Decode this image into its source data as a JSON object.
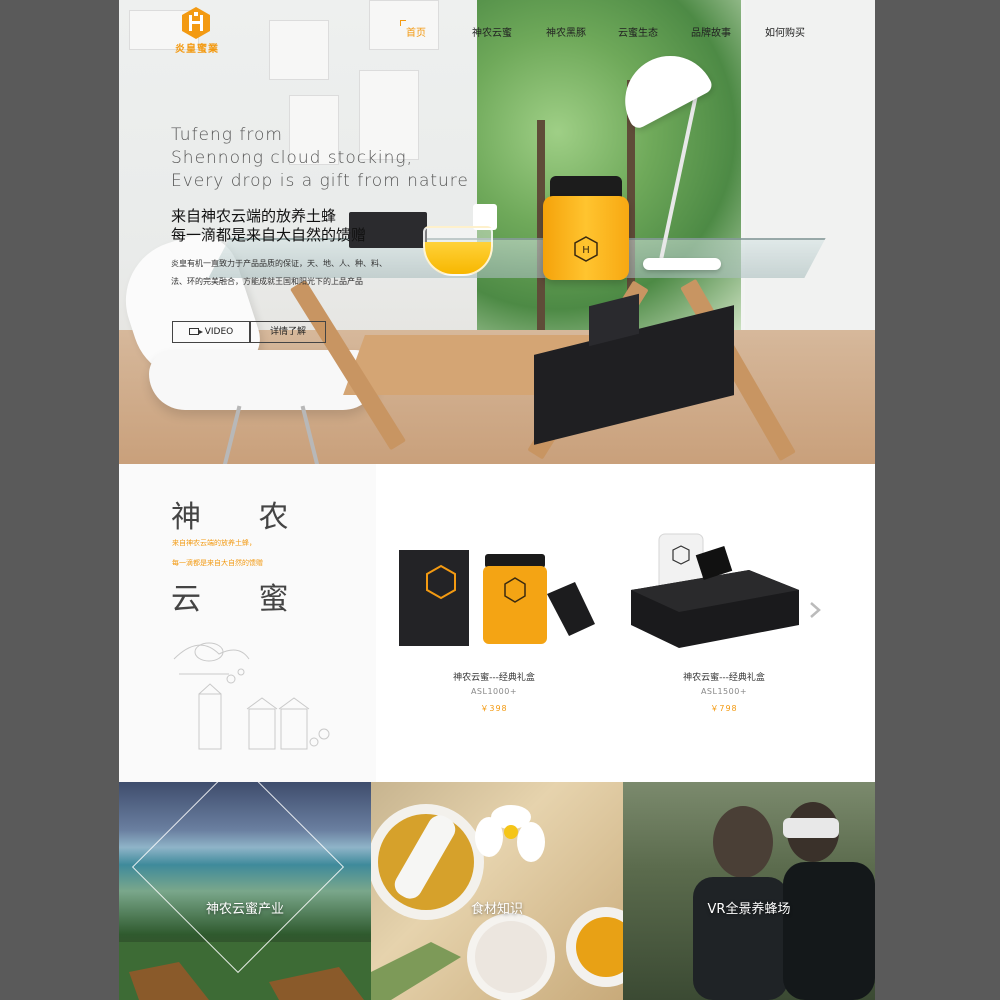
{
  "brand": {
    "logo_text": "炎皇蜜業",
    "accent_color": "#f39a12"
  },
  "nav": {
    "items": [
      {
        "label": "首页",
        "active": true
      },
      {
        "label": "神农云蜜",
        "active": false
      },
      {
        "label": "神农黑豚",
        "active": false
      },
      {
        "label": "云蜜生态",
        "active": false
      },
      {
        "label": "品牌故事",
        "active": false
      },
      {
        "label": "如何购买",
        "active": false
      }
    ]
  },
  "hero": {
    "en_line1": "Tufeng from",
    "en_line2": "Shennong cloud stocking,",
    "en_line3": "Every drop is a gift from nature",
    "cn_line1": "来自神农云端的放养土蜂",
    "cn_line2": "每一滴都是来自大自然的馈赠",
    "small_line1": "炎皇有机一直致力于产品品质的保证，天、地、人、种、料、",
    "small_line2": "法、环的完美融合，方能成就王国和阳光下的上品产品",
    "video_button": "VIDEO",
    "detail_button": "详情了解"
  },
  "products_section": {
    "title_top": "神  农",
    "title_bottom": "云  蜜",
    "note_line1": "来自神农云端的放养土蜂，",
    "note_line2": "每一滴都是来自大自然的馈赠",
    "items": [
      {
        "name": "神农云蜜---经典礼盒",
        "code": "ASL1000+",
        "price": "￥398"
      },
      {
        "name": "神农云蜜---经典礼盒",
        "code": "ASL1500+",
        "price": "￥798"
      }
    ],
    "next_icon": "chevron-right-icon"
  },
  "tiles": [
    {
      "label": "神农云蜜产业"
    },
    {
      "label": "食材知识"
    },
    {
      "label": "VR全景养蜂场"
    }
  ]
}
